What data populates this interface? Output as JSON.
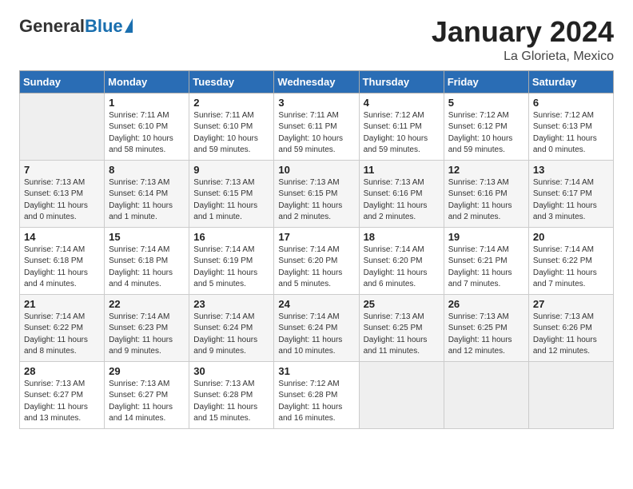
{
  "header": {
    "logo_general": "General",
    "logo_blue": "Blue",
    "month_title": "January 2024",
    "location": "La Glorieta, Mexico"
  },
  "columns": [
    "Sunday",
    "Monday",
    "Tuesday",
    "Wednesday",
    "Thursday",
    "Friday",
    "Saturday"
  ],
  "weeks": [
    [
      {
        "day": "",
        "empty": true
      },
      {
        "day": "1",
        "sunrise": "7:11 AM",
        "sunset": "6:10 PM",
        "daylight": "10 hours and 58 minutes."
      },
      {
        "day": "2",
        "sunrise": "7:11 AM",
        "sunset": "6:10 PM",
        "daylight": "10 hours and 59 minutes."
      },
      {
        "day": "3",
        "sunrise": "7:11 AM",
        "sunset": "6:11 PM",
        "daylight": "10 hours and 59 minutes."
      },
      {
        "day": "4",
        "sunrise": "7:12 AM",
        "sunset": "6:11 PM",
        "daylight": "10 hours and 59 minutes."
      },
      {
        "day": "5",
        "sunrise": "7:12 AM",
        "sunset": "6:12 PM",
        "daylight": "10 hours and 59 minutes."
      },
      {
        "day": "6",
        "sunrise": "7:12 AM",
        "sunset": "6:13 PM",
        "daylight": "11 hours and 0 minutes."
      }
    ],
    [
      {
        "day": "7",
        "sunrise": "7:13 AM",
        "sunset": "6:13 PM",
        "daylight": "11 hours and 0 minutes."
      },
      {
        "day": "8",
        "sunrise": "7:13 AM",
        "sunset": "6:14 PM",
        "daylight": "11 hours and 1 minute."
      },
      {
        "day": "9",
        "sunrise": "7:13 AM",
        "sunset": "6:15 PM",
        "daylight": "11 hours and 1 minute."
      },
      {
        "day": "10",
        "sunrise": "7:13 AM",
        "sunset": "6:15 PM",
        "daylight": "11 hours and 2 minutes."
      },
      {
        "day": "11",
        "sunrise": "7:13 AM",
        "sunset": "6:16 PM",
        "daylight": "11 hours and 2 minutes."
      },
      {
        "day": "12",
        "sunrise": "7:13 AM",
        "sunset": "6:16 PM",
        "daylight": "11 hours and 2 minutes."
      },
      {
        "day": "13",
        "sunrise": "7:14 AM",
        "sunset": "6:17 PM",
        "daylight": "11 hours and 3 minutes."
      }
    ],
    [
      {
        "day": "14",
        "sunrise": "7:14 AM",
        "sunset": "6:18 PM",
        "daylight": "11 hours and 4 minutes."
      },
      {
        "day": "15",
        "sunrise": "7:14 AM",
        "sunset": "6:18 PM",
        "daylight": "11 hours and 4 minutes."
      },
      {
        "day": "16",
        "sunrise": "7:14 AM",
        "sunset": "6:19 PM",
        "daylight": "11 hours and 5 minutes."
      },
      {
        "day": "17",
        "sunrise": "7:14 AM",
        "sunset": "6:20 PM",
        "daylight": "11 hours and 5 minutes."
      },
      {
        "day": "18",
        "sunrise": "7:14 AM",
        "sunset": "6:20 PM",
        "daylight": "11 hours and 6 minutes."
      },
      {
        "day": "19",
        "sunrise": "7:14 AM",
        "sunset": "6:21 PM",
        "daylight": "11 hours and 7 minutes."
      },
      {
        "day": "20",
        "sunrise": "7:14 AM",
        "sunset": "6:22 PM",
        "daylight": "11 hours and 7 minutes."
      }
    ],
    [
      {
        "day": "21",
        "sunrise": "7:14 AM",
        "sunset": "6:22 PM",
        "daylight": "11 hours and 8 minutes."
      },
      {
        "day": "22",
        "sunrise": "7:14 AM",
        "sunset": "6:23 PM",
        "daylight": "11 hours and 9 minutes."
      },
      {
        "day": "23",
        "sunrise": "7:14 AM",
        "sunset": "6:24 PM",
        "daylight": "11 hours and 9 minutes."
      },
      {
        "day": "24",
        "sunrise": "7:14 AM",
        "sunset": "6:24 PM",
        "daylight": "11 hours and 10 minutes."
      },
      {
        "day": "25",
        "sunrise": "7:13 AM",
        "sunset": "6:25 PM",
        "daylight": "11 hours and 11 minutes."
      },
      {
        "day": "26",
        "sunrise": "7:13 AM",
        "sunset": "6:25 PM",
        "daylight": "11 hours and 12 minutes."
      },
      {
        "day": "27",
        "sunrise": "7:13 AM",
        "sunset": "6:26 PM",
        "daylight": "11 hours and 12 minutes."
      }
    ],
    [
      {
        "day": "28",
        "sunrise": "7:13 AM",
        "sunset": "6:27 PM",
        "daylight": "11 hours and 13 minutes."
      },
      {
        "day": "29",
        "sunrise": "7:13 AM",
        "sunset": "6:27 PM",
        "daylight": "11 hours and 14 minutes."
      },
      {
        "day": "30",
        "sunrise": "7:13 AM",
        "sunset": "6:28 PM",
        "daylight": "11 hours and 15 minutes."
      },
      {
        "day": "31",
        "sunrise": "7:12 AM",
        "sunset": "6:28 PM",
        "daylight": "11 hours and 16 minutes."
      },
      {
        "day": "",
        "empty": true
      },
      {
        "day": "",
        "empty": true
      },
      {
        "day": "",
        "empty": true
      }
    ]
  ],
  "labels": {
    "sunrise": "Sunrise:",
    "sunset": "Sunset:",
    "daylight": "Daylight:"
  }
}
